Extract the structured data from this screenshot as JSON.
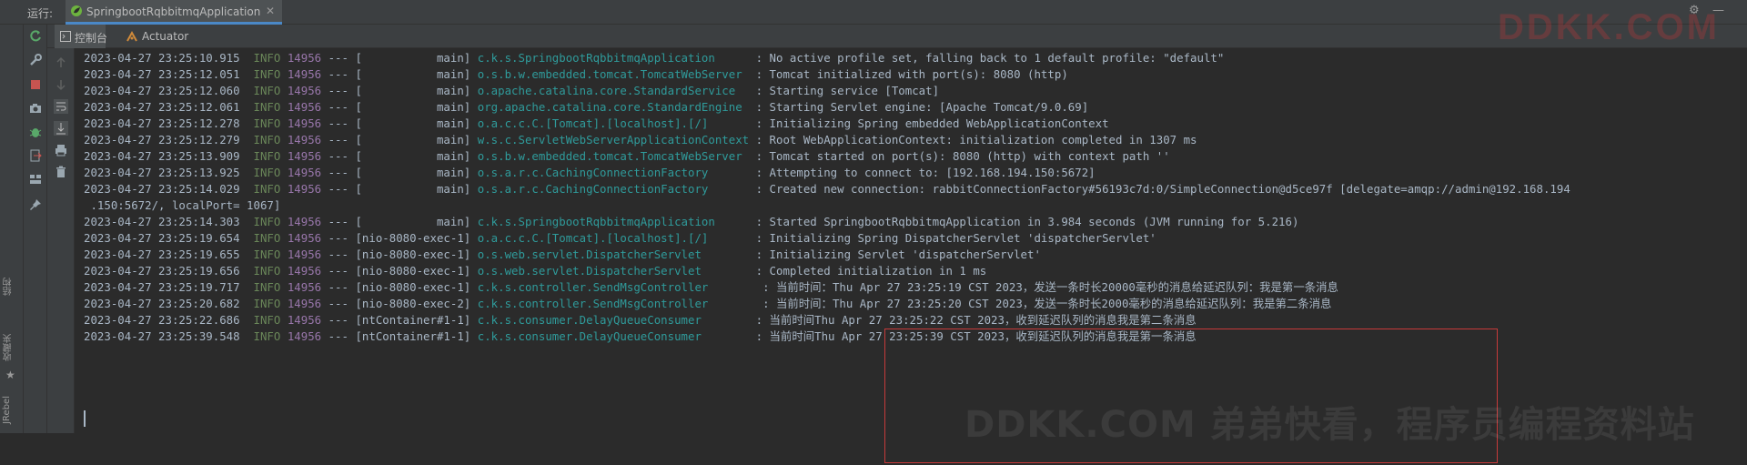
{
  "header": {
    "run_label": "运行:",
    "tab_title": "SpringbootRqbbitmqApplication"
  },
  "subtabs": [
    {
      "label": "控制台"
    },
    {
      "label": "Actuator"
    }
  ],
  "sidebar": {
    "labels": [
      "结构",
      "收藏夹",
      "JRebel"
    ]
  },
  "icons": {
    "left_strip": [
      "rerun-icon",
      "wrench-icon",
      "stop-icon",
      "camera-icon",
      "debug-bug-icon",
      "exit-icon",
      "layout-icon",
      "pin-icon"
    ],
    "tool_strip": [
      "up-arrow-icon",
      "down-arrow-icon",
      "soft-wrap-icon",
      "scroll-to-end-icon",
      "print-icon",
      "trash-icon"
    ]
  },
  "colors": {
    "timestamp": "#a9b7c6",
    "level": "#6a8759",
    "pid": "#9876aa",
    "class": "#2f9b9b",
    "highlight_box": "#c63a3a"
  },
  "console": {
    "lines": [
      {
        "ts": "2023-04-27 23:25:10.915",
        "level": "INFO",
        "pid": "14956",
        "sep": "---",
        "thread": "[           main]",
        "cls": "c.k.s.SpringbootRqbbitmqApplication     ",
        "msg": ": No active profile set, falling back to 1 default profile: \"default\""
      },
      {
        "ts": "2023-04-27 23:25:12.051",
        "level": "INFO",
        "pid": "14956",
        "sep": "---",
        "thread": "[           main]",
        "cls": "o.s.b.w.embedded.tomcat.TomcatWebServer ",
        "msg": ": Tomcat initialized with port(s): 8080 (http)"
      },
      {
        "ts": "2023-04-27 23:25:12.060",
        "level": "INFO",
        "pid": "14956",
        "sep": "---",
        "thread": "[           main]",
        "cls": "o.apache.catalina.core.StandardService  ",
        "msg": ": Starting service [Tomcat]"
      },
      {
        "ts": "2023-04-27 23:25:12.061",
        "level": "INFO",
        "pid": "14956",
        "sep": "---",
        "thread": "[           main]",
        "cls": "org.apache.catalina.core.StandardEngine ",
        "msg": ": Starting Servlet engine: [Apache Tomcat/9.0.69]"
      },
      {
        "ts": "2023-04-27 23:25:12.278",
        "level": "INFO",
        "pid": "14956",
        "sep": "---",
        "thread": "[           main]",
        "cls": "o.a.c.c.C.[Tomcat].[localhost].[/]      ",
        "msg": ": Initializing Spring embedded WebApplicationContext"
      },
      {
        "ts": "2023-04-27 23:25:12.279",
        "level": "INFO",
        "pid": "14956",
        "sep": "---",
        "thread": "[           main]",
        "cls": "w.s.c.ServletWebServerApplicationContext",
        "msg": ": Root WebApplicationContext: initialization completed in 1307 ms"
      },
      {
        "ts": "2023-04-27 23:25:13.909",
        "level": "INFO",
        "pid": "14956",
        "sep": "---",
        "thread": "[           main]",
        "cls": "o.s.b.w.embedded.tomcat.TomcatWebServer ",
        "msg": ": Tomcat started on port(s): 8080 (http) with context path ''"
      },
      {
        "ts": "2023-04-27 23:25:13.925",
        "level": "INFO",
        "pid": "14956",
        "sep": "---",
        "thread": "[           main]",
        "cls": "o.s.a.r.c.CachingConnectionFactory      ",
        "msg": ": Attempting to connect to: [192.168.194.150:5672]"
      },
      {
        "ts": "2023-04-27 23:25:14.029",
        "level": "INFO",
        "pid": "14956",
        "sep": "---",
        "thread": "[           main]",
        "cls": "o.s.a.r.c.CachingConnectionFactory      ",
        "msg": ": Created new connection: rabbitConnectionFactory#56193c7d:0/SimpleConnection@d5ce97f [delegate=amqp://admin@192.168.194"
      },
      {
        "cont": " .150:5672/, localPort= 1067]"
      },
      {
        "ts": "2023-04-27 23:25:14.303",
        "level": "INFO",
        "pid": "14956",
        "sep": "---",
        "thread": "[           main]",
        "cls": "c.k.s.SpringbootRqbbitmqApplication     ",
        "msg": ": Started SpringbootRqbbitmqApplication in 3.984 seconds (JVM running for 5.216)"
      },
      {
        "ts": "2023-04-27 23:25:19.654",
        "level": "INFO",
        "pid": "14956",
        "sep": "---",
        "thread": "[nio-8080-exec-1]",
        "cls": "o.a.c.c.C.[Tomcat].[localhost].[/]      ",
        "msg": ": Initializing Spring DispatcherServlet 'dispatcherServlet'"
      },
      {
        "ts": "2023-04-27 23:25:19.655",
        "level": "INFO",
        "pid": "14956",
        "sep": "---",
        "thread": "[nio-8080-exec-1]",
        "cls": "o.s.web.servlet.DispatcherServlet       ",
        "msg": ": Initializing Servlet 'dispatcherServlet'"
      },
      {
        "ts": "2023-04-27 23:25:19.656",
        "level": "INFO",
        "pid": "14956",
        "sep": "---",
        "thread": "[nio-8080-exec-1]",
        "cls": "o.s.web.servlet.DispatcherServlet       ",
        "msg": ": Completed initialization in 1 ms"
      },
      {
        "ts": "2023-04-27 23:25:19.717",
        "level": "INFO",
        "pid": "14956",
        "sep": "---",
        "thread": "[nio-8080-exec-1]",
        "cls": "c.k.s.controller.SendMsgController       ",
        "msg": ": 当前时间：Thu Apr 27 23:25:19 CST 2023，发送一条时长20000毫秒的消息给延迟队列：我是第一条消息"
      },
      {
        "ts": "2023-04-27 23:25:20.682",
        "level": "INFO",
        "pid": "14956",
        "sep": "---",
        "thread": "[nio-8080-exec-2]",
        "cls": "c.k.s.controller.SendMsgController       ",
        "msg": ": 当前时间：Thu Apr 27 23:25:20 CST 2023，发送一条时长2000毫秒的消息给延迟队列：我是第二条消息"
      },
      {
        "ts": "2023-04-27 23:25:22.686",
        "level": "INFO",
        "pid": "14956",
        "sep": "---",
        "thread": "[ntContainer#1-1]",
        "cls": "c.k.s.consumer.DelayQueueConsumer       ",
        "msg": ": 当前时间Thu Apr 27 23:25:22 CST 2023，收到延迟队列的消息我是第二条消息"
      },
      {
        "ts": "2023-04-27 23:25:39.548",
        "level": "INFO",
        "pid": "14956",
        "sep": "---",
        "thread": "[ntContainer#1-1]",
        "cls": "c.k.s.consumer.DelayQueueConsumer       ",
        "msg": ": 当前时间Thu Apr 27 23:25:39 CST 2023，收到延迟队列的消息我是第一条消息"
      }
    ]
  },
  "watermarks": {
    "top": "DDKK.COM",
    "bottom": "DDKK.COM 弟弟快看，程序员编程资料站"
  }
}
